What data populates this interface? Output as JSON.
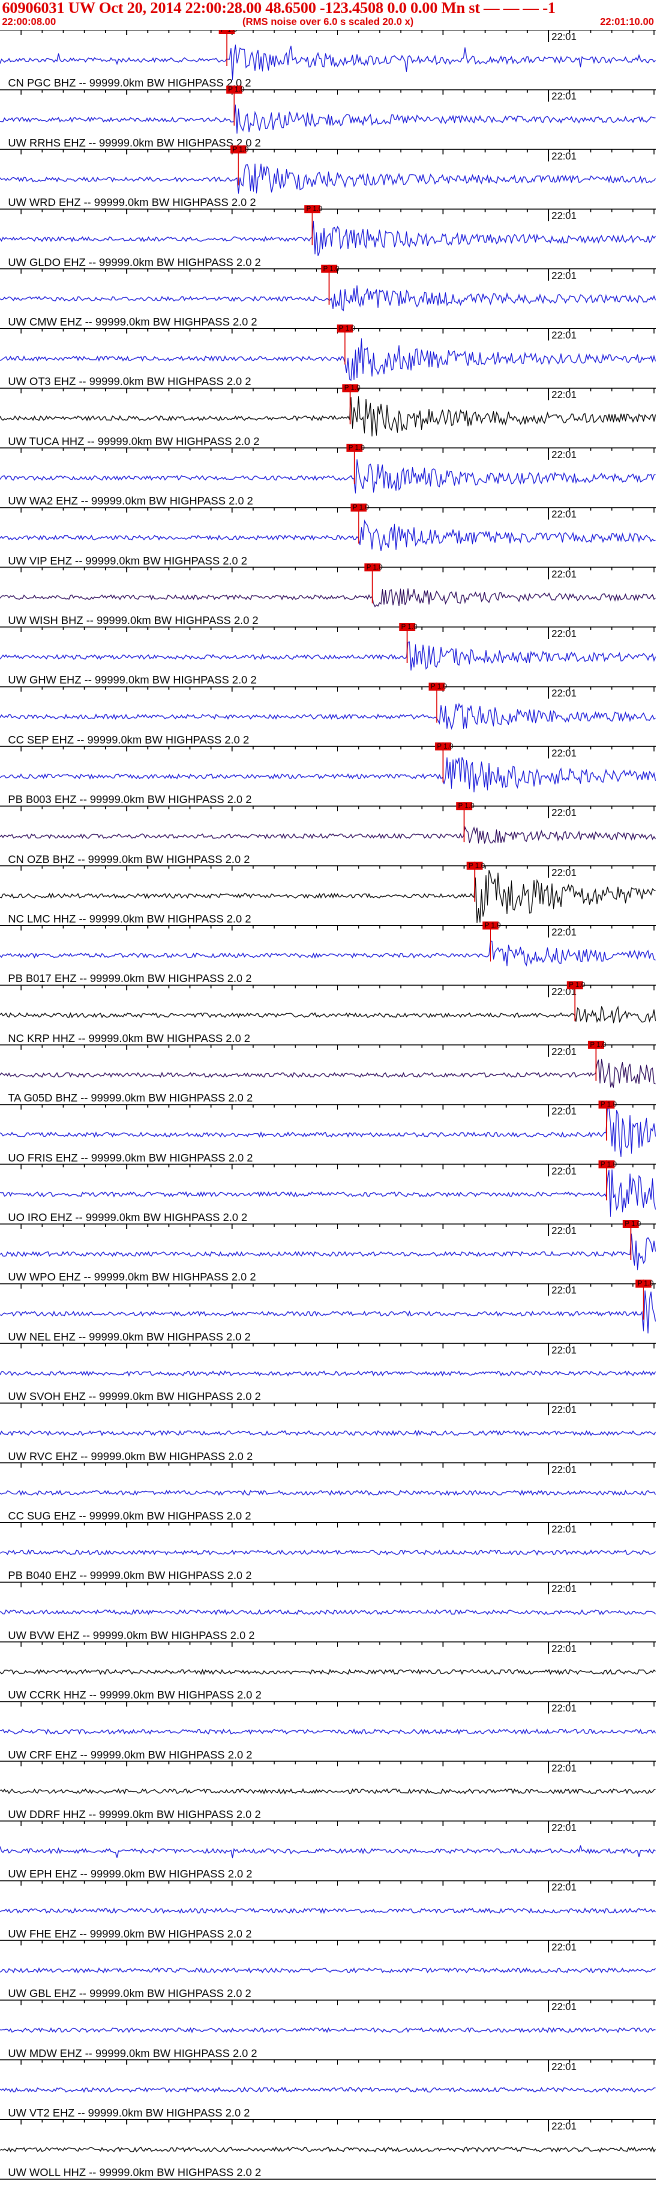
{
  "header": {
    "title": "60906031 UW Oct 20, 2014 22:00:28.00   48.6500 -123.4508  0.0 0.00 Mn st — — — -1",
    "start_time": "22:00:08.00",
    "note": "(RMS noise over 6.0 s scaled 20.0 x)",
    "end_time": "22:01:10.00"
  },
  "chart_data": {
    "type": "line",
    "title": "60906031 UW Oct 20, 2014 22:00:28.00   48.6500 -123.4508  0.0 0.00 Mn st — — — -1",
    "xlim": [
      "22:00:08.00",
      "22:01:10.00"
    ],
    "tick_label": "22:01",
    "colors": {
      "blue": "#1515d8",
      "black": "#000000",
      "purple": "#2a0858",
      "pick": "#dd0000"
    },
    "traces": [
      {
        "label": "CN PGC BHZ -- 99999.0km BW  HIGHPASS  2.0  2",
        "color": "blue",
        "pick_time_s": 29.5,
        "pick_label": "P 1.0",
        "onset_s": 29.5,
        "amplitude": 0.5,
        "spikes": true
      },
      {
        "label": "UW RRHS EHZ -- 99999.0km BW  HIGHPASS  2.0  2",
        "color": "blue",
        "pick_time_s": 30.2,
        "pick_label": "P 1.0",
        "onset_s": 30.2,
        "amplitude": 0.45
      },
      {
        "label": "UW WRD EHZ -- 99999.0km BW  HIGHPASS  2.0  2",
        "color": "blue",
        "pick_time_s": 30.6,
        "pick_label": "P 1.0",
        "onset_s": 30.6,
        "amplitude": 0.6
      },
      {
        "label": "UW GLDO EHZ -- 99999.0km BW  HIGHPASS  2.0  2",
        "color": "blue",
        "pick_time_s": 37.6,
        "pick_label": "P 1.0",
        "onset_s": 37.6,
        "amplitude": 0.55
      },
      {
        "label": "UW CMW EHZ -- 99999.0km BW  HIGHPASS  2.0  2",
        "color": "blue",
        "pick_time_s": 39.2,
        "pick_label": "P 1.0",
        "onset_s": 39.2,
        "amplitude": 0.55
      },
      {
        "label": "UW OT3 EHZ -- 99999.0km BW  HIGHPASS  2.0  2",
        "color": "blue",
        "pick_time_s": 40.7,
        "pick_label": "P 1.0",
        "onset_s": 40.7,
        "amplitude": 0.75
      },
      {
        "label": "UW TUCA HHZ -- 99999.0km BW  HIGHPASS  2.0  2",
        "color": "black",
        "pick_time_s": 41.2,
        "pick_label": "P 1.0",
        "onset_s": 41.2,
        "amplitude": 0.75
      },
      {
        "label": "UW WA2 EHZ -- 99999.0km BW  HIGHPASS  2.0  2",
        "color": "blue",
        "pick_time_s": 41.6,
        "pick_label": "P 1.0",
        "onset_s": 41.6,
        "amplitude": 0.65
      },
      {
        "label": "UW VIP EHZ -- 99999.0km BW  HIGHPASS  2.0  2",
        "color": "blue",
        "pick_time_s": 42.0,
        "pick_label": "P 1.0",
        "onset_s": 42.0,
        "amplitude": 0.6
      },
      {
        "label": "UW WISH BHZ -- 99999.0km BW  HIGHPASS  2.0  2",
        "color": "purple",
        "pick_time_s": 43.3,
        "pick_label": "P 1.0",
        "onset_s": 43.3,
        "amplitude": 0.35
      },
      {
        "label": "UW GHW EHZ -- 99999.0km BW  HIGHPASS  2.0  2",
        "color": "blue",
        "pick_time_s": 46.6,
        "pick_label": "P 1.0",
        "onset_s": 46.6,
        "amplitude": 0.45
      },
      {
        "label": "CC SEP EHZ -- 99999.0km BW  HIGHPASS  2.0  2",
        "color": "blue",
        "pick_time_s": 49.4,
        "pick_label": "P 1.0",
        "onset_s": 49.4,
        "amplitude": 0.5
      },
      {
        "label": "PB B003 EHZ -- 99999.0km BW  HIGHPASS  2.0  2",
        "color": "blue",
        "pick_time_s": 50.0,
        "pick_label": "P 1.0",
        "onset_s": 50.0,
        "amplitude": 0.75
      },
      {
        "label": "CN OZB BHZ -- 99999.0km BW  HIGHPASS  2.0  2",
        "color": "purple",
        "pick_time_s": 52.0,
        "pick_label": "P 1.0",
        "onset_s": 52.0,
        "amplitude": 0.25
      },
      {
        "label": "NC LMC HHZ -- 99999.0km BW  HIGHPASS  2.0  2",
        "color": "black",
        "pick_time_s": 53.0,
        "pick_label": "P 1.0",
        "onset_s": 53.0,
        "amplitude": 1.0
      },
      {
        "label": "PB B017 EHZ -- 99999.0km BW  HIGHPASS  2.0  2",
        "color": "blue",
        "pick_time_s": 54.5,
        "pick_label": "P 1.0",
        "onset_s": 54.5,
        "amplitude": 0.45
      },
      {
        "label": "NC KRP HHZ -- 99999.0km BW  HIGHPASS  2.0  2",
        "color": "black",
        "pick_time_s": 62.5,
        "pick_label": "P 1.0",
        "onset_s": 62.5,
        "amplitude": 0.35
      },
      {
        "label": "TA G05D BHZ -- 99999.0km BW  HIGHPASS  2.0  2",
        "color": "purple",
        "pick_time_s": 64.5,
        "pick_label": "P 1.0",
        "onset_s": 64.5,
        "amplitude": 0.5
      },
      {
        "label": "UO FRIS EHZ -- 99999.0km BW  HIGHPASS  2.0  2",
        "color": "blue",
        "pick_time_s": 65.5,
        "pick_label": "P 1.0",
        "onset_s": 65.5,
        "amplitude": 0.85
      },
      {
        "label": "UO IRO EHZ -- 99999.0km BW  HIGHPASS  2.0  2",
        "color": "blue",
        "pick_time_s": 65.5,
        "pick_label": "P 1.0",
        "onset_s": 65.5,
        "amplitude": 0.85
      },
      {
        "label": "UW WPO EHZ -- 99999.0km BW  HIGHPASS  2.0  2",
        "color": "blue",
        "pick_time_s": 67.8,
        "pick_label": "P 1.0",
        "onset_s": 67.8,
        "amplitude": 0.7
      },
      {
        "label": "UW NEL EHZ -- 99999.0km BW  HIGHPASS  2.0  2",
        "color": "blue",
        "pick_time_s": 69.0,
        "pick_label": "P 1.0",
        "onset_s": 69.0,
        "amplitude": 0.75
      },
      {
        "label": "UW SVOH EHZ -- 99999.0km BW  HIGHPASS  2.0  2",
        "color": "blue",
        "pick_time_s": 72.5,
        "pick_label": "P 1.0",
        "onset_s": 72.5,
        "amplitude": 0.35
      },
      {
        "label": "UW RVC EHZ -- 99999.0km BW  HIGHPASS  2.0  2",
        "color": "blue",
        "pick_time_s": 76.0,
        "pick_label": "P 1.0",
        "onset_s": 76.0,
        "amplitude": 0.3
      },
      {
        "label": "CC SUG EHZ -- 99999.0km BW  HIGHPASS  2.0  2",
        "color": "blue",
        "pick_time_s": 79.5,
        "pick_label": "P 1.0",
        "onset_s": 79.5,
        "amplitude": 0.8
      },
      {
        "label": "PB B040 EHZ -- 99999.0km BW  HIGHPASS  2.0  2",
        "color": "blue",
        "pick_time_s": 79.5,
        "pick_label": "P 1.0",
        "onset_s": 79.5,
        "amplitude": 0.55
      },
      {
        "label": "UW BVW EHZ -- 99999.0km BW  HIGHPASS  2.0  2",
        "color": "blue",
        "pick_time_s": null,
        "onset_s": null,
        "amplitude": 0.2
      },
      {
        "label": "UW CCRK HHZ -- 99999.0km BW  HIGHPASS  2.0  2",
        "color": "black",
        "pick_time_s": null,
        "onset_s": null,
        "amplitude": 0.25
      },
      {
        "label": "UW CRF EHZ -- 99999.0km BW  HIGHPASS  2.0  2",
        "color": "blue",
        "pick_time_s": null,
        "onset_s": null,
        "amplitude": 0.3
      },
      {
        "label": "UW DDRF HHZ -- 99999.0km BW  HIGHPASS  2.0  2",
        "color": "black",
        "pick_time_s": null,
        "onset_s": null,
        "amplitude": 0.3
      },
      {
        "label": "UW EPH EHZ -- 99999.0km BW  HIGHPASS  2.0  2",
        "color": "blue",
        "pick_time_s": null,
        "onset_s": null,
        "amplitude": 0.25,
        "spikes": true
      },
      {
        "label": "UW FHE EHZ -- 99999.0km BW  HIGHPASS  2.0  2",
        "color": "blue",
        "pick_time_s": null,
        "onset_s": null,
        "amplitude": 0.3
      },
      {
        "label": "UW GBL EHZ -- 99999.0km BW  HIGHPASS  2.0  2",
        "color": "blue",
        "pick_time_s": null,
        "onset_s": null,
        "amplitude": 0.3
      },
      {
        "label": "UW MDW EHZ -- 99999.0km BW  HIGHPASS  2.0  2",
        "color": "blue",
        "pick_time_s": null,
        "onset_s": null,
        "amplitude": 0.2
      },
      {
        "label": "UW VT2 EHZ -- 99999.0km BW  HIGHPASS  2.0  2",
        "color": "blue",
        "pick_time_s": null,
        "onset_s": null,
        "amplitude": 0.25
      },
      {
        "label": "UW WOLL HHZ -- 99999.0km BW  HIGHPASS  2.0  2",
        "color": "black",
        "pick_time_s": null,
        "onset_s": null,
        "amplitude": 0.3
      }
    ]
  }
}
